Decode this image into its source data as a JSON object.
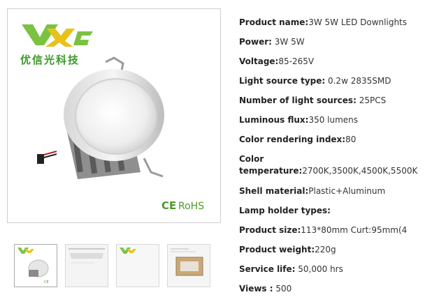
{
  "brand": {
    "logo_text": "YXG",
    "logo_chinese": "优信光科技",
    "cert_ce": "CE",
    "cert_rohs": "RoHS"
  },
  "thumbnails": [
    {
      "caption": "",
      "selected": true
    },
    {
      "caption": "",
      "selected": false
    },
    {
      "caption": "",
      "selected": false
    },
    {
      "caption": "",
      "selected": false
    }
  ],
  "specs": {
    "product_name": {
      "label": "Product name:",
      "value": "3W 5W LED Downlights"
    },
    "power": {
      "label": "Power:",
      "value": " 3W 5W"
    },
    "voltage": {
      "label": "Voltage:",
      "value": "85-265V"
    },
    "light_source_type": {
      "label": "Light source type:",
      "value": " 0.2w 2835SMD"
    },
    "number_light_sources": {
      "label": "Number of light sources:",
      "value": " 25PCS"
    },
    "luminous_flux": {
      "label": "Luminous flux:",
      "value": "350 lumens"
    },
    "cri": {
      "label": "Color rendering index:",
      "value": "80"
    },
    "color_temp": {
      "label_line1": "Color",
      "label_line2": "temperature:",
      "value": "2700K,3500K,4500K,5500K"
    },
    "shell_material": {
      "label": "Shell material:",
      "value": "Plastic+Aluminum"
    },
    "lamp_holder": {
      "label": "Lamp holder types:",
      "value": ""
    },
    "product_size": {
      "label": "Product size:",
      "value": "113*80mm Curt:95mm(4"
    },
    "product_weight": {
      "label": "Product weight:",
      "value": "220g"
    },
    "service_life": {
      "label": "Service life:",
      "value": " 50,000 hrs"
    },
    "views": {
      "label": "Views :",
      "value": " 500"
    }
  },
  "colors": {
    "logo_green": "#7cc242",
    "logo_yellow": "#e8c21a",
    "chinese_green": "#3c9a2a",
    "rohs_green": "#4a9a2a"
  }
}
